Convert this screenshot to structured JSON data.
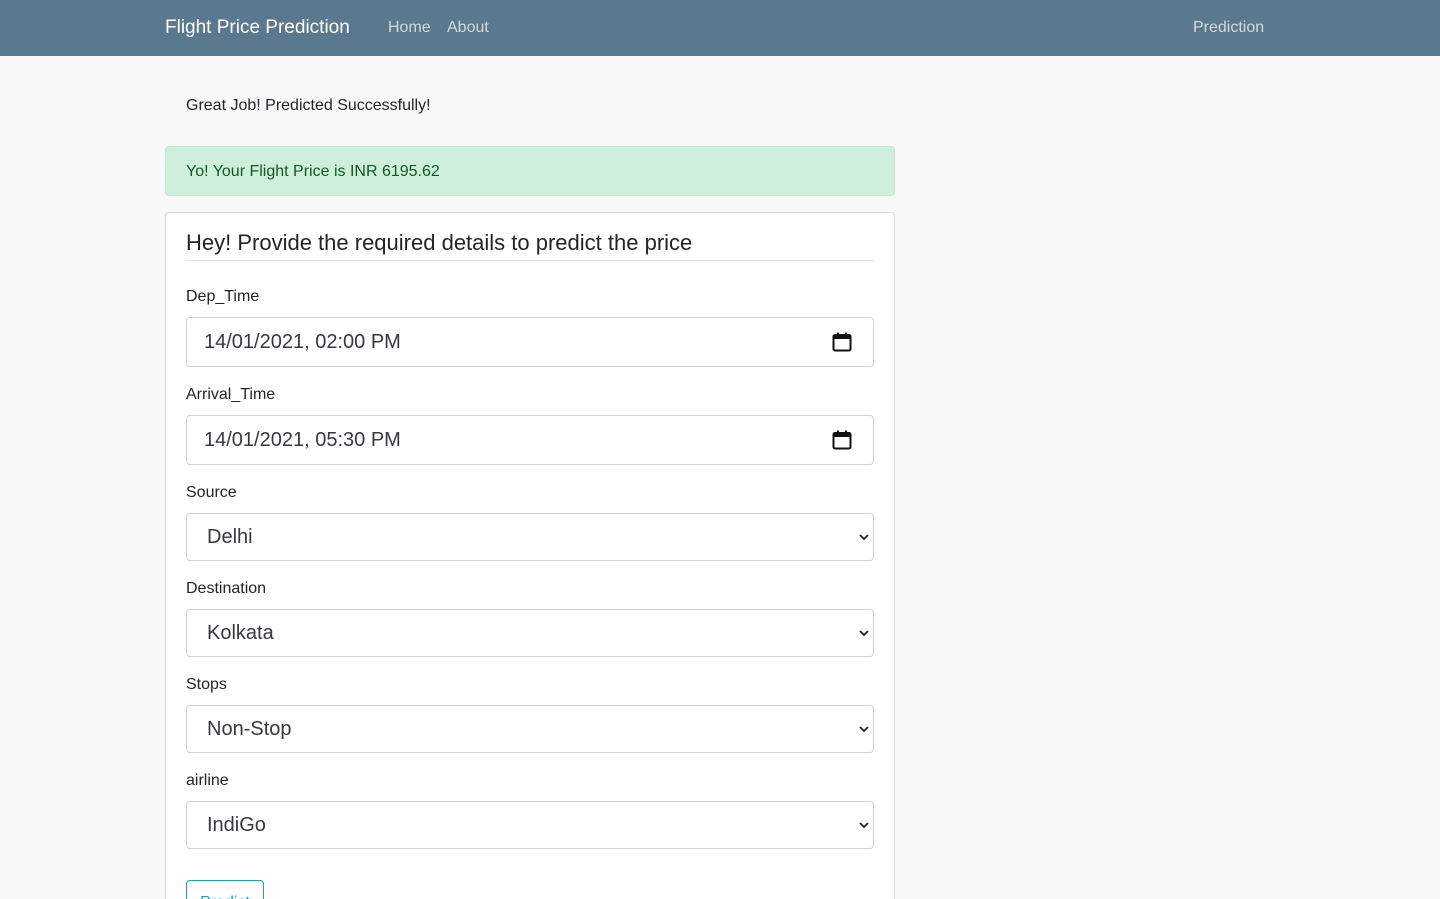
{
  "navbar": {
    "brand": "Flight Price Prediction",
    "links": [
      "Home",
      "About"
    ],
    "right_link": "Prediction",
    "color": "#5a788e"
  },
  "status": {
    "message": "Great Job! Predicted Successfully!",
    "result": "Yo! Your Flight Price is INR 6195.62",
    "result_color": "#cdefdc"
  },
  "form": {
    "title": "Hey! Provide the required details to predict the price",
    "dep_time": {
      "label": "Dep_Time",
      "value": "14/01/2021, 02:00 PM",
      "icon": "calendar-icon"
    },
    "arrival_time": {
      "label": "Arrival_Time",
      "value": "14/01/2021, 05:30 PM",
      "icon": "calendar-icon"
    },
    "source": {
      "label": "Source",
      "value": "Delhi"
    },
    "destination": {
      "label": "Destination",
      "value": "Kolkata"
    },
    "stops": {
      "label": "Stops",
      "value": "Non-Stop"
    },
    "airline": {
      "label": "airline",
      "value": "IndiGo"
    },
    "submit_label": "Predict",
    "submit_color": "#17a2b8"
  }
}
